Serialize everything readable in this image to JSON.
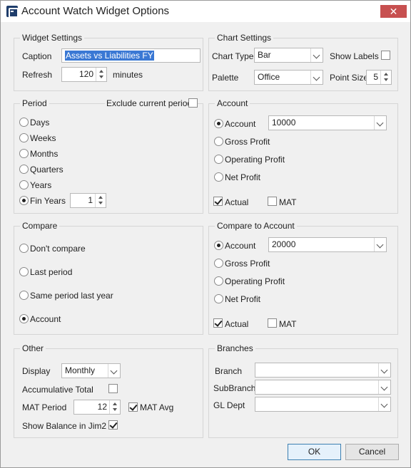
{
  "window": {
    "title": "Account Watch Widget Options",
    "close_glyph": "✕"
  },
  "widget_settings": {
    "legend": "Widget Settings",
    "caption_label": "Caption",
    "caption_value": "Assets vs Liabilities FY",
    "refresh_label": "Refresh",
    "refresh_value": "120",
    "refresh_unit": "minutes"
  },
  "chart_settings": {
    "legend": "Chart Settings",
    "chart_type_label": "Chart Type",
    "chart_type_value": "Bar",
    "show_labels_label": "Show Labels",
    "show_labels_checked": false,
    "palette_label": "Palette",
    "palette_value": "Office",
    "point_size_label": "Point Size",
    "point_size_value": "5"
  },
  "period": {
    "legend": "Period",
    "exclude_label": "Exclude current period",
    "exclude_checked": false,
    "options": [
      "Days",
      "Weeks",
      "Months",
      "Quarters",
      "Years",
      "Fin Years"
    ],
    "selected": "Fin Years",
    "fin_years_value": "1"
  },
  "account": {
    "legend": "Account",
    "account_label": "Account",
    "account_value": "10000",
    "options": [
      "Gross Profit",
      "Operating Profit",
      "Net Profit"
    ],
    "selected": "Account",
    "actual_label": "Actual",
    "actual_checked": true,
    "mat_label": "MAT",
    "mat_checked": false
  },
  "compare": {
    "legend": "Compare",
    "options": [
      "Don't compare",
      "Last period",
      "Same period last year",
      "Account"
    ],
    "selected": "Account"
  },
  "compare_to_account": {
    "legend": "Compare to Account",
    "account_label": "Account",
    "account_value": "20000",
    "options": [
      "Gross Profit",
      "Operating Profit",
      "Net Profit"
    ],
    "selected": "Account",
    "actual_label": "Actual",
    "actual_checked": true,
    "mat_label": "MAT",
    "mat_checked": false
  },
  "other": {
    "legend": "Other",
    "display_label": "Display",
    "display_value": "Monthly",
    "accumulative_label": "Accumulative Total",
    "accumulative_checked": false,
    "mat_period_label": "MAT Period",
    "mat_period_value": "12",
    "mat_avg_label": "MAT Avg",
    "mat_avg_checked": true,
    "show_balance_label": "Show Balance in Jim2",
    "show_balance_checked": true
  },
  "branches": {
    "legend": "Branches",
    "branch_label": "Branch",
    "branch_value": "",
    "subbranch_label": "SubBranch",
    "subbranch_value": "",
    "gl_dept_label": "GL Dept",
    "gl_dept_value": ""
  },
  "footer": {
    "ok_label": "OK",
    "cancel_label": "Cancel"
  },
  "colors": {
    "close_button": "#c75050",
    "selection": "#3a78d4",
    "window_bg": "#f0f0f0"
  }
}
